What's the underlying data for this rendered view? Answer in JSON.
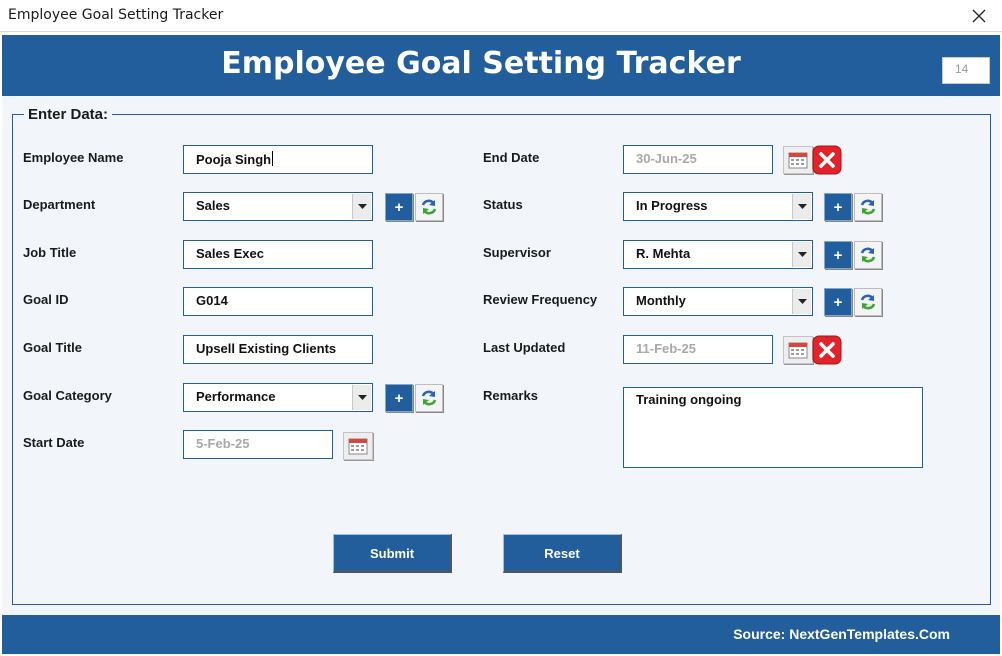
{
  "window": {
    "title": "Employee Goal Setting Tracker",
    "close_icon": "close-icon"
  },
  "header": {
    "title": "Employee Goal Setting Tracker",
    "record_count": "14"
  },
  "form": {
    "group_label": "Enter Data:",
    "employee_name": {
      "label": "Employee Name",
      "value": "Pooja Singh"
    },
    "department": {
      "label": "Department",
      "value": "Sales"
    },
    "job_title": {
      "label": "Job Title",
      "value": "Sales Exec"
    },
    "goal_id": {
      "label": "Goal ID",
      "value": "G014"
    },
    "goal_title": {
      "label": "Goal Title",
      "value": "Upsell Existing Clients"
    },
    "goal_category": {
      "label": "Goal Category",
      "value": "Performance"
    },
    "start_date": {
      "label": "Start Date",
      "value": "5-Feb-25"
    },
    "end_date": {
      "label": "End Date",
      "value": "30-Jun-25"
    },
    "status": {
      "label": "Status",
      "value": "In Progress"
    },
    "supervisor": {
      "label": "Supervisor",
      "value": "R. Mehta"
    },
    "review_frequency": {
      "label": "Review Frequency",
      "value": "Monthly"
    },
    "last_updated": {
      "label": "Last Updated",
      "value": "11-Feb-25"
    },
    "remarks": {
      "label": "Remarks",
      "value": "Training ongoing"
    }
  },
  "buttons": {
    "add": "+",
    "submit": "Submit",
    "reset": "Reset"
  },
  "footer": {
    "source": "Source: NextGenTemplates.Com"
  },
  "colors": {
    "brand_blue": "#225d9c",
    "panel_bg": "#f2f6fa",
    "clear_red": "#e0242a",
    "refresh_green": "#3aa635"
  }
}
